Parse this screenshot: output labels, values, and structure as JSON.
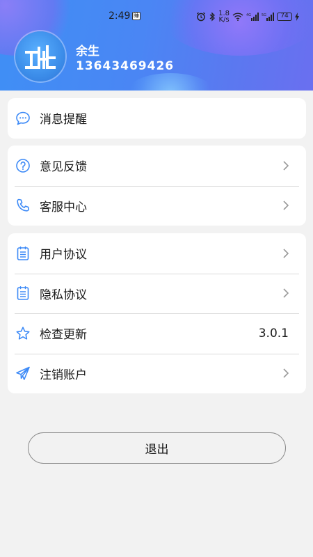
{
  "status_bar": {
    "time": "2:49",
    "app_indicator": "睡",
    "net_speed_top": "1.8",
    "net_speed_bottom": "K/s",
    "battery": "74"
  },
  "profile": {
    "name": "余生",
    "phone": "13643469426"
  },
  "colors": {
    "accent": "#4a86f4",
    "icon": "#3d8af7",
    "background": "#f2f2f2"
  },
  "menu_groups": [
    {
      "items": [
        {
          "label": "消息提醒",
          "icon": "message-bubble-icon"
        }
      ]
    },
    {
      "items": [
        {
          "label": "意见反馈",
          "icon": "question-circle-icon"
        },
        {
          "label": "客服中心",
          "icon": "phone-icon"
        }
      ]
    },
    {
      "items": [
        {
          "label": "用户协议",
          "icon": "document-icon"
        },
        {
          "label": "隐私协议",
          "icon": "document-icon"
        },
        {
          "label": "检查更新",
          "icon": "star-icon",
          "value": "3.0.1"
        },
        {
          "label": "注销账户",
          "icon": "paper-plane-icon"
        }
      ]
    }
  ],
  "logout_label": "退出"
}
